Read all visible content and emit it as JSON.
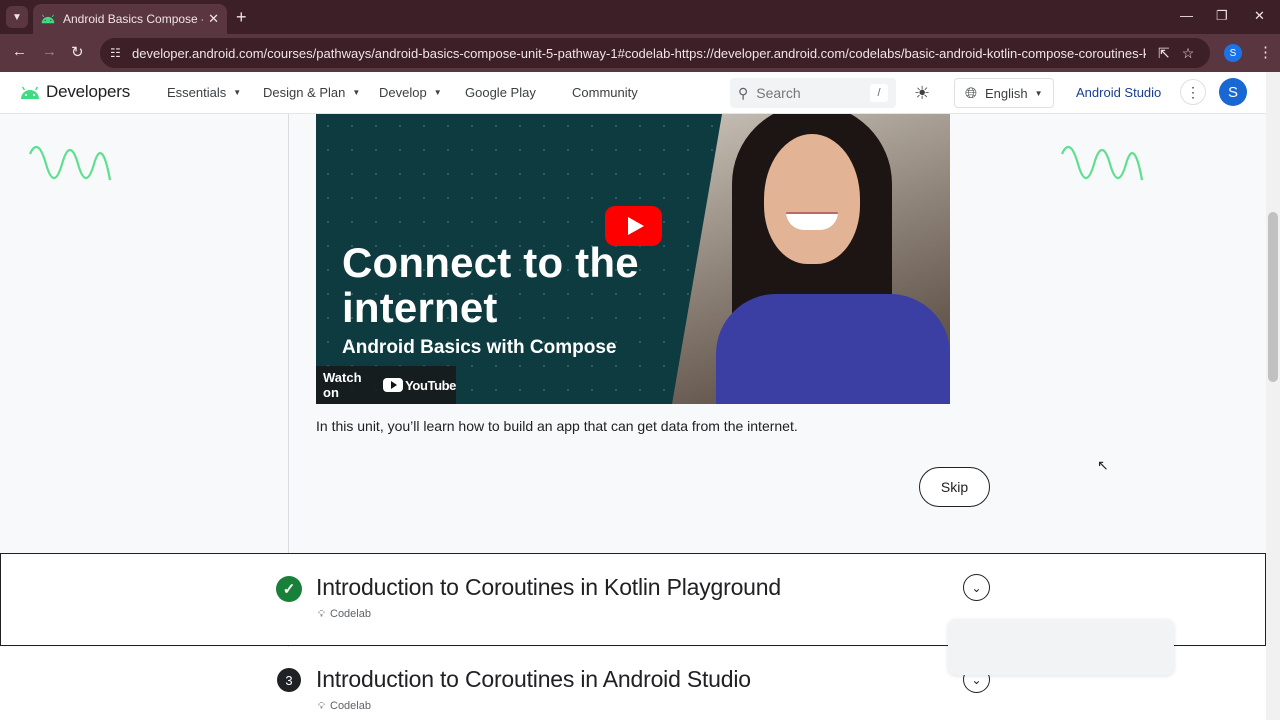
{
  "browser": {
    "tab_title": "Android Basics Compose - Get",
    "url": "developer.android.com/courses/pathways/android-basics-compose-unit-5-pathway-1#codelab-https://developer.android.com/codelabs/basic-android-kotlin-compose-coroutines-kotlin-playgrou...",
    "profile_initial": "S",
    "icons": [
      "tab-list",
      "close",
      "plus",
      "minimize",
      "restore",
      "close",
      "back",
      "forward",
      "reload",
      "site-info",
      "install",
      "star",
      "more-vert"
    ]
  },
  "header": {
    "logo_text": "Developers",
    "nav": [
      "Essentials",
      "Design & Plan",
      "Develop",
      "Google Play",
      "Community"
    ],
    "search_placeholder": "Search",
    "search_shortcut": "/",
    "language": "English",
    "android_studio": "Android Studio",
    "avatar_initial": "S",
    "brand_color": "#3ddc84"
  },
  "video": {
    "title": "Connect to the internet",
    "subtitle": "Android Basics with Compose",
    "watch_on": "Watch on",
    "youtube": "YouTube"
  },
  "unit_description": "In this unit, you’ll learn how to build an app that can get data from the internet.",
  "skip_label": "Skip",
  "lessons": [
    {
      "status": "✓",
      "title": "Introduction to Coroutines in Kotlin Playground",
      "type": "Codelab"
    },
    {
      "status": "3",
      "title": "Introduction to Coroutines in Android Studio",
      "type": "Codelab"
    }
  ]
}
